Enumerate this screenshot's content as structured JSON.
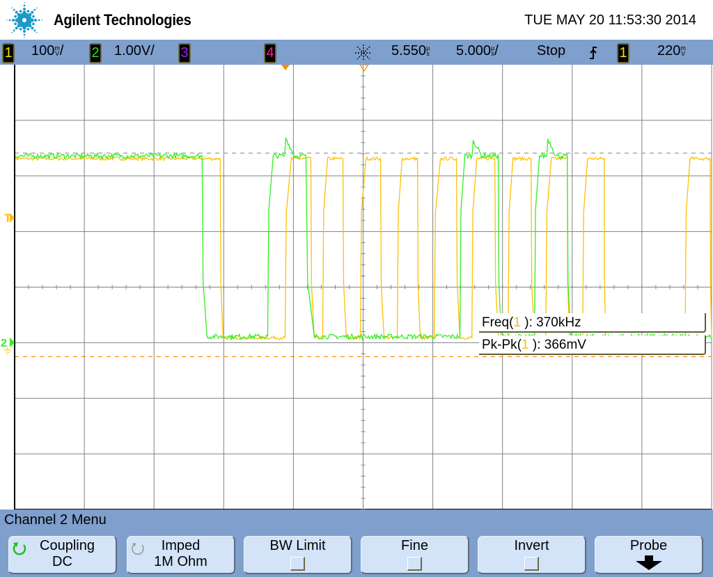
{
  "header": {
    "brand": "Agilent Technologies",
    "datetime": "TUE MAY 20 11:53:30 2014",
    "logo_color": "#1a9ac9"
  },
  "channel_bar": {
    "ch1": {
      "num": "1",
      "scale": "100",
      "unit_top": "m",
      "unit_bottom": "V",
      "suffix": "/",
      "color": "#f5e600"
    },
    "ch2": {
      "num": "2",
      "scale": "1.00V/",
      "color": "#22e022"
    },
    "ch3": {
      "num": "3",
      "color": "#a020f0"
    },
    "ch4": {
      "num": "4",
      "color": "#ff1493"
    },
    "delay": {
      "value": "5.550",
      "unit_top": "µ",
      "unit_bottom": "s"
    },
    "timebase": {
      "value": "5.000",
      "unit_top": "µ",
      "unit_bottom": "s",
      "suffix": "/"
    },
    "run_state": "Stop",
    "trigger_edge_icon": "rising-edge-icon",
    "trigger_source": "1",
    "trigger_level": {
      "value": "220",
      "unit_top": "m",
      "unit_bottom": "V"
    }
  },
  "markers": {
    "trigger_label": "T",
    "ch2_label": "2"
  },
  "measurements": [
    {
      "name": "Freq",
      "source": "1",
      "value": "370kHz"
    },
    {
      "name": "Pk-Pk",
      "source": "1",
      "value": "366mV"
    }
  ],
  "chart_data": {
    "type": "line",
    "title": "",
    "x_divisions": 10,
    "y_divisions": 8,
    "xlim_div": [
      0,
      10
    ],
    "ylim_div": [
      -4,
      4
    ],
    "grid": true,
    "series": [
      {
        "name": "Channel 1",
        "color": "#ffc000",
        "high_div": 2.31,
        "low_div": -0.91,
        "initial": "high",
        "edges_div": [
          [
            2.95,
            2.99
          ],
          [
            3.88,
            3.97
          ],
          [
            4.25,
            4.3
          ],
          [
            4.42,
            4.49
          ],
          [
            4.71,
            4.76
          ],
          [
            4.96,
            5.04
          ],
          [
            5.25,
            5.3
          ],
          [
            5.49,
            5.56
          ],
          [
            5.78,
            5.82
          ],
          [
            6.02,
            6.11
          ],
          [
            6.34,
            6.39
          ],
          [
            6.56,
            6.63
          ],
          [
            6.89,
            6.94
          ],
          [
            7.08,
            7.15
          ],
          [
            7.41,
            7.46
          ],
          [
            7.62,
            7.7
          ],
          [
            7.93,
            7.96
          ],
          [
            8.15,
            8.22
          ],
          [
            8.46,
            8.48
          ],
          [
            9.62,
            9.69
          ],
          [
            9.98,
            10.0
          ]
        ]
      },
      {
        "name": "Channel 2",
        "color": "#33ee22",
        "high_div": 2.36,
        "low_div": -0.89,
        "initial": "high",
        "edges_div": [
          [
            2.69,
            2.76
          ],
          [
            3.63,
            3.71
          ],
          [
            4.18,
            4.3
          ],
          [
            6.39,
            6.46
          ],
          [
            6.94,
            6.98
          ],
          [
            7.46,
            7.53
          ],
          [
            7.93,
            7.98
          ]
        ],
        "overshoot_div": [
          [
            3.89,
            0.33
          ],
          [
            6.58,
            0.29
          ],
          [
            7.65,
            0.31
          ]
        ]
      }
    ],
    "reference_lines": [
      {
        "name": "trigger-level-line",
        "y_div": 2.41,
        "color": "#999999"
      },
      {
        "name": "ch1-ground-line",
        "y_div": -1.25,
        "color": "#ff8c00"
      }
    ]
  },
  "menu": {
    "title": "Channel 2  Menu",
    "softkeys": [
      {
        "label": "Coupling",
        "value": "DC",
        "icon": "rotate-active"
      },
      {
        "label": "Imped",
        "value": "1M Ohm",
        "icon": "rotate-inactive"
      },
      {
        "label": "BW Limit",
        "checkbox": false
      },
      {
        "label": "Fine",
        "checkbox": false
      },
      {
        "label": "Invert",
        "checkbox": false
      },
      {
        "label": "Probe",
        "icon": "down-arrow"
      }
    ]
  }
}
